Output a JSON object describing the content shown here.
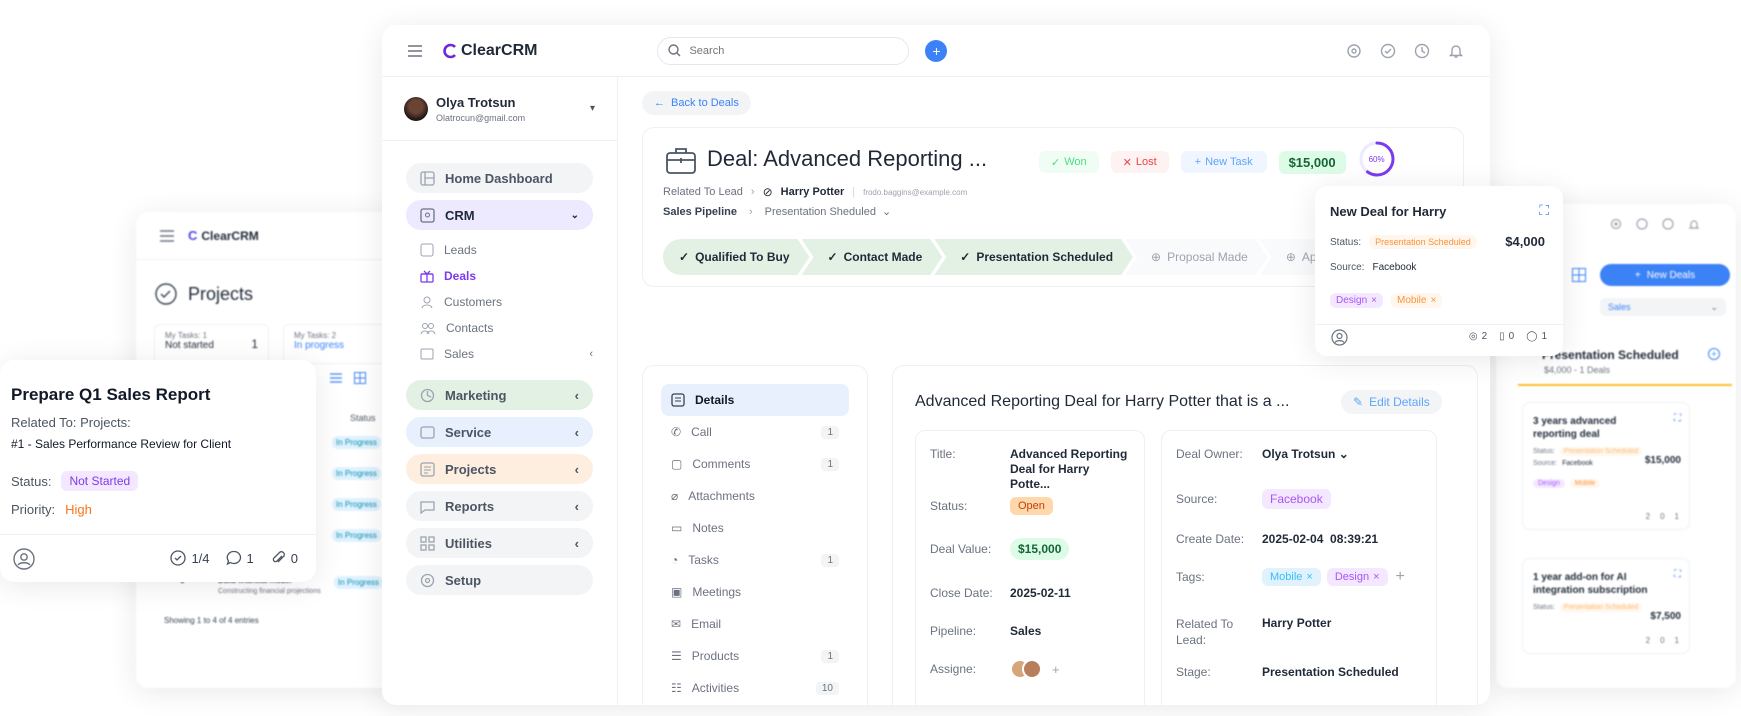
{
  "brand": "ClearCRM",
  "search": {
    "placeholder": "Search"
  },
  "user": {
    "name": "Olya Trotsun",
    "email": "Olatrocun@gmail.com"
  },
  "nav": {
    "home": "Home Dashboard",
    "crm": "CRM",
    "leads": "Leads",
    "deals": "Deals",
    "customers": "Customers",
    "contacts": "Contacts",
    "sales": "Sales",
    "marketing": "Marketing",
    "service": "Service",
    "projects": "Projects",
    "reports": "Reports",
    "utilities": "Utilities",
    "setup": "Setup"
  },
  "deal": {
    "back": "Back to Deals",
    "title": "Deal: Advanced Reporting ...",
    "won": "Won",
    "lost": "Lost",
    "new_task": "New Task",
    "amount": "$15,000",
    "progress_label": "60%",
    "progress": 0.6,
    "related_label": "Related To Lead",
    "related_name": "Harry Potter",
    "related_email": "frodo.baggins@example.com",
    "pipeline_label": "Sales Pipeline",
    "pipeline_stage": "Presentation Sheduled",
    "stages": [
      "Qualified To Buy",
      "Contact Made",
      "Presentation Scheduled",
      "Proposal Made",
      "Appointm"
    ]
  },
  "tabs": [
    {
      "label": "Details",
      "count": ""
    },
    {
      "label": "Call",
      "count": "1"
    },
    {
      "label": "Comments",
      "count": "1"
    },
    {
      "label": "Attachments",
      "count": ""
    },
    {
      "label": "Notes",
      "count": ""
    },
    {
      "label": "Tasks",
      "count": "1"
    },
    {
      "label": "Meetings",
      "count": ""
    },
    {
      "label": "Email",
      "count": ""
    },
    {
      "label": "Products",
      "count": "1"
    },
    {
      "label": "Activities",
      "count": "10"
    }
  ],
  "details": {
    "heading": "Advanced Reporting Deal for Harry Potter that is a ...",
    "edit": "Edit Details",
    "title_label": "Title:",
    "title_val": "Advanced Reporting Deal for Harry Potte...",
    "status_label": "Status:",
    "status_val": "Open",
    "value_label": "Deal Value:",
    "value_val": "$15,000",
    "close_label": "Close Date:",
    "close_val": "2025-02-11",
    "pipeline_label": "Pipeline:",
    "pipeline_val": "Sales",
    "assignee_label": "Assigne:",
    "owner_label": "Deal Owner:",
    "owner_val": "Olya Trotsun",
    "source_label": "Source:",
    "source_val": "Facebook",
    "create_label": "Create Date:",
    "create_val": "2025-02-04  08:39:21",
    "tags_label": "Tags:",
    "tag1": "Mobile",
    "tag2": "Design",
    "rel_label": "Related To Lead:",
    "rel_val": "Harry Potter",
    "stage_label": "Stage:",
    "stage_val": "Presentation Scheduled"
  },
  "popup": {
    "title": "New Deal for Harry",
    "status_label": "Status:",
    "status_val": "Presentation Scheduled",
    "amount": "$4,000",
    "source_label": "Source:",
    "source_val": "Facebook",
    "tag1": "Design",
    "tag2": "Mobile",
    "c1": "2",
    "c2": "0",
    "c3": "1"
  },
  "kanban": {
    "new_deals": "New Deals",
    "filter": "Sales",
    "column": "Presentation Scheduled",
    "column_sub": "$4,000 - 1 Deals",
    "cards": [
      {
        "title": "3 years advanced reporting deal",
        "status_label": "Status:",
        "status": "Presentation Scheduled",
        "amount": "$15,000",
        "source_label": "Source:",
        "source": "Facebook",
        "tag1": "Design",
        "tag2": "Mobile",
        "c1": "2",
        "c2": "0",
        "c3": "1"
      },
      {
        "title": "1 year add-on for AI integration subscription",
        "status_label": "Status:",
        "status": "Presentation Scheduled",
        "amount": "$7,500",
        "c1": "2",
        "c2": "0",
        "c3": "1"
      }
    ]
  },
  "projects": {
    "brand": "ClearCRM",
    "title": "Projects",
    "box1_label": "My Tasks: 1",
    "box1_val": "Not started",
    "box1_num": "1",
    "box2_label": "My Tasks: 2",
    "box2_val": "In progress",
    "status_col": "Status",
    "row_status": "In Progress",
    "row_title": "Build financial model",
    "row_sub": "Constructing financial projections",
    "row_num": "1",
    "footer": "Showing 1 to 4 of 4 entries"
  },
  "task": {
    "title": "Prepare Q1 Sales Report",
    "related_label": "Related To: Projects:",
    "related_val": "#1 - Sales Performance Review for Client",
    "status_label": "Status:",
    "status_val": "Not Started",
    "priority_label": "Priority:",
    "priority_val": "High",
    "checks": "1/4",
    "comments": "1",
    "attachments": "0"
  },
  "colors": {
    "accent": "#3b82f6",
    "purple": "#7c3aed",
    "green": "#22c55e",
    "red": "#ef4444",
    "orange": "#f97316"
  }
}
